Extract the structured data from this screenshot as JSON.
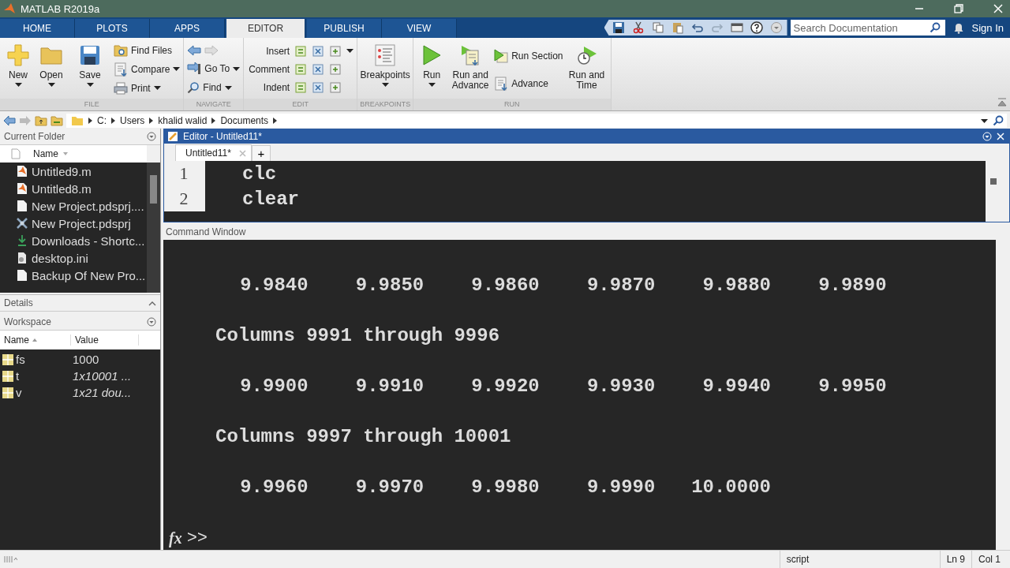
{
  "window": {
    "title": "MATLAB R2019a"
  },
  "tabs": [
    {
      "label": "HOME",
      "selected": false
    },
    {
      "label": "PLOTS",
      "selected": false
    },
    {
      "label": "APPS",
      "selected": false
    },
    {
      "label": "EDITOR",
      "selected": true
    },
    {
      "label": "PUBLISH",
      "selected": false
    },
    {
      "label": "VIEW",
      "selected": false
    }
  ],
  "search": {
    "placeholder": "Search Documentation"
  },
  "sign_in": "Sign In",
  "ribbon": {
    "groups": [
      {
        "label": "FILE",
        "columns": [
          {
            "kind": "big",
            "items": [
              {
                "label": "New",
                "dropdown": true
              }
            ]
          },
          {
            "kind": "big",
            "items": [
              {
                "label": "Open",
                "dropdown": true
              }
            ]
          },
          {
            "kind": "big",
            "items": [
              {
                "label": "Save",
                "dropdown": true
              }
            ]
          },
          {
            "kind": "small",
            "items": [
              {
                "label": "Find Files",
                "dropdown": false
              },
              {
                "label": "Compare",
                "dropdown": true
              },
              {
                "label": "Print",
                "dropdown": true
              }
            ]
          }
        ]
      },
      {
        "label": "NAVIGATE",
        "columns": [
          {
            "kind": "nav",
            "items": [
              {
                "label": "Go To",
                "dropdown": true
              },
              {
                "label": "Find",
                "dropdown": true
              }
            ]
          }
        ]
      },
      {
        "label": "EDIT",
        "columns": [
          {
            "kind": "rows",
            "items": [
              {
                "label": "Insert",
                "dropdown": true
              },
              {
                "label": "Comment",
                "dropdown": false
              },
              {
                "label": "Indent",
                "dropdown": false
              }
            ]
          }
        ]
      },
      {
        "label": "BREAKPOINTS",
        "columns": [
          {
            "kind": "big",
            "items": [
              {
                "label": "Breakpoints",
                "dropdown": true
              }
            ]
          }
        ]
      },
      {
        "label": "RUN",
        "columns": [
          {
            "kind": "big",
            "items": [
              {
                "label": "Run",
                "dropdown": true
              }
            ]
          },
          {
            "kind": "big",
            "items": [
              {
                "label": "Run and Advance",
                "dropdown": false
              }
            ]
          },
          {
            "kind": "small",
            "items": [
              {
                "label": "Run Section",
                "dropdown": false
              },
              {
                "label": "Advance",
                "dropdown": false
              }
            ]
          },
          {
            "kind": "big",
            "items": [
              {
                "label": "Run and Time",
                "dropdown": false
              }
            ]
          }
        ]
      }
    ]
  },
  "address_bar": {
    "path": [
      "C:",
      "Users",
      "khalid walid",
      "Documents"
    ]
  },
  "current_folder": {
    "title": "Current Folder",
    "column": "Name",
    "files": [
      {
        "name": "Untitled9.m",
        "kind": "mfile"
      },
      {
        "name": "Untitled8.m",
        "kind": "mfile"
      },
      {
        "name": "New Project.pdsprj....",
        "kind": "doc"
      },
      {
        "name": "New Project.pdsprj",
        "kind": "project"
      },
      {
        "name": "Downloads - Shortc...",
        "kind": "shortcut"
      },
      {
        "name": "desktop.ini",
        "kind": "ini"
      },
      {
        "name": "Backup Of New Pro...",
        "kind": "doc"
      }
    ]
  },
  "details": {
    "title": "Details"
  },
  "workspace": {
    "title": "Workspace",
    "columns": [
      "Name",
      "Value"
    ],
    "variables": [
      {
        "name": "fs",
        "value": "1000",
        "kind": "scalar"
      },
      {
        "name": "t",
        "value": "1x10001 ...",
        "kind": "matrix"
      },
      {
        "name": "v",
        "value": "1x21 dou...",
        "kind": "matrix"
      }
    ]
  },
  "editor": {
    "title": "Editor - Untitled11*",
    "tabs": [
      {
        "label": "Untitled11*",
        "selected": true
      }
    ],
    "new_tab": "+",
    "lines": [
      {
        "number": "1",
        "code": "clc"
      },
      {
        "number": "2",
        "code": "clear"
      }
    ]
  },
  "command_window": {
    "title": "Command Window",
    "output": [
      {
        "kind": "values",
        "values": [
          "9.9840",
          "9.9850",
          "9.9860",
          "9.9870",
          "9.9880",
          "9.9890"
        ]
      },
      {
        "kind": "header",
        "text": "Columns 9991 through 9996"
      },
      {
        "kind": "values",
        "values": [
          "9.9900",
          "9.9910",
          "9.9920",
          "9.9930",
          "9.9940",
          "9.9950"
        ]
      },
      {
        "kind": "header",
        "text": "Columns 9997 through 10001"
      },
      {
        "kind": "values",
        "values": [
          "9.9960",
          "9.9970",
          "9.9980",
          "9.9990",
          "10.0000"
        ]
      }
    ],
    "fx": "fx",
    "prompt": ">>"
  },
  "status_bar": {
    "mode": "script",
    "line": "Ln 9",
    "column": "Col 1"
  }
}
